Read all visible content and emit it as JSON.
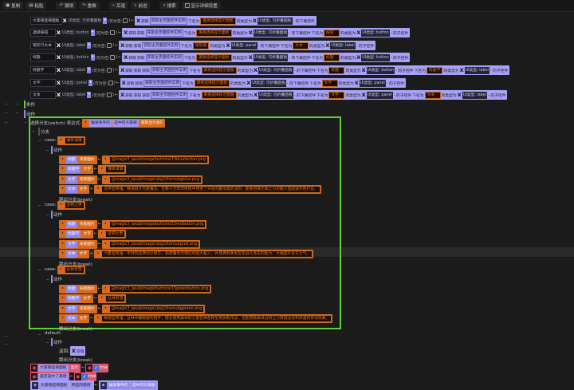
{
  "toolbar": {
    "items": [
      {
        "icon": "copy-icon",
        "label": "复制"
      },
      {
        "icon": "paste-icon",
        "label": "粘贴"
      },
      {
        "icon": "undo-icon",
        "label": "撤销"
      },
      {
        "icon": "redo-icon",
        "label": "重做"
      },
      {
        "icon": "back-icon",
        "label": "后退"
      },
      {
        "icon": "forward-icon",
        "label": "前进"
      },
      {
        "icon": "search-icon",
        "label": "搜索"
      }
    ],
    "detail_checkbox": "显示详细设置"
  },
  "vars": [
    {
      "name": "大美德选择面板",
      "type": "UI类型: 可折叠面板",
      "chain": [
        [
          "x",
          ""
        ],
        [
          "txt",
          "获取"
        ],
        [
          "inner",
          "获取主页面控件实例"
        ],
        [
          "txt",
          "下名为"
        ],
        [
          "str",
          "美德选择提示面板"
        ],
        [
          "txt",
          "的类型为"
        ],
        [
          "x",
          ""
        ],
        [
          "typ",
          "UI类型: 可折叠面板"
        ],
        [
          "txt",
          "- 的下属控件"
        ]
      ]
    },
    {
      "name": "选择按钮",
      "type": "UI类型: button",
      "chain": [
        [
          "x",
          ""
        ],
        [
          "txt",
          "获取"
        ],
        [
          "txt",
          "获取"
        ],
        [
          "inner",
          "获取主页面控件实例"
        ],
        [
          "txt",
          "下名为"
        ],
        [
          "str",
          "美德选择提示面板"
        ],
        [
          "txt",
          "的类型为"
        ],
        [
          "x",
          ""
        ],
        [
          "typ",
          "UI类型: 可折叠面板"
        ],
        [
          "txt",
          "- 的下属控件"
        ],
        [
          "txt",
          "下名为"
        ],
        [
          "str",
          "按钮"
        ],
        [
          "txt",
          "的类型为"
        ],
        [
          "x",
          ""
        ],
        [
          "typ",
          "UI类型: button"
        ],
        [
          "txt",
          "- 的子控件"
        ]
      ]
    },
    {
      "name": "矩形行文本",
      "type": "UI类型: label",
      "chain": [
        [
          "x",
          ""
        ],
        [
          "txt",
          "获取"
        ],
        [
          "txt",
          "获取"
        ],
        [
          "inner",
          "获取主页面控件实例"
        ],
        [
          "txt",
          "下名为"
        ],
        [
          "str",
          "矩形框"
        ],
        [
          "txt",
          "的类型为"
        ],
        [
          "x",
          ""
        ],
        [
          "typ",
          "UI类型: panel"
        ],
        [
          "txt",
          "- 的下属控件"
        ],
        [
          "txt",
          "下名为"
        ],
        [
          "str",
          "文本"
        ],
        [
          "txt",
          "的类型为"
        ],
        [
          "x",
          ""
        ],
        [
          "typ",
          "UI类型: label"
        ],
        [
          "txt",
          "- 的子控件"
        ]
      ]
    },
    {
      "name": "标题",
      "type": "UI类型: button",
      "chain": [
        [
          "x",
          ""
        ],
        [
          "txt",
          "获取"
        ],
        [
          "txt",
          "获取"
        ],
        [
          "inner",
          "获取主页面控件实例"
        ],
        [
          "txt",
          "下名为"
        ],
        [
          "str",
          "美德选择提示面板"
        ],
        [
          "txt",
          "的类型为"
        ],
        [
          "x",
          ""
        ],
        [
          "typ",
          "UI类型: 可折叠面板"
        ],
        [
          "txt",
          "- 的下属控件"
        ],
        [
          "txt",
          "下名为"
        ],
        [
          "str",
          "标题"
        ],
        [
          "txt",
          "的类型为"
        ],
        [
          "x",
          ""
        ],
        [
          "typ",
          "UI类型: button"
        ],
        [
          "txt",
          "- 的子控件"
        ]
      ]
    },
    {
      "name": "标题字",
      "type": "UI类型: label",
      "chain": [
        [
          "x",
          ""
        ],
        [
          "txt",
          "获取"
        ],
        [
          "txt",
          "获取"
        ],
        [
          "txt",
          "获取"
        ],
        [
          "inner",
          "获取主页面控件实例"
        ],
        [
          "txt",
          "下名为"
        ],
        [
          "str",
          "美德选择提示面板"
        ],
        [
          "txt",
          "的类型为"
        ],
        [
          "x",
          ""
        ],
        [
          "typ",
          "UI类型: 可折叠面板"
        ],
        [
          "txt",
          "- 的下属控件"
        ],
        [
          "txt",
          "下名为"
        ],
        [
          "str",
          "标题"
        ],
        [
          "txt",
          "的类型为"
        ],
        [
          "x",
          ""
        ],
        [
          "typ",
          "UI类型: button"
        ],
        [
          "txt",
          "- 的子控件"
        ],
        [
          "txt",
          "下名为"
        ],
        [
          "str",
          "标题字"
        ],
        [
          "txt",
          "的类型为"
        ],
        [
          "x",
          ""
        ],
        [
          "typ",
          "UI类型: label"
        ],
        [
          "txt",
          "- 的子控件"
        ]
      ]
    },
    {
      "name": "文字",
      "type": "UI类型: panel",
      "chain": [
        [
          "x",
          ""
        ],
        [
          "txt",
          "获取"
        ],
        [
          "txt",
          "获取"
        ],
        [
          "inner",
          "获取主页面控件实例"
        ],
        [
          "txt",
          "下名为"
        ],
        [
          "str",
          "美德选择提示面板"
        ],
        [
          "txt",
          "的类型为"
        ],
        [
          "x",
          ""
        ],
        [
          "typ",
          "UI类型: 可折叠面板"
        ],
        [
          "txt",
          "- 的下属控件"
        ],
        [
          "txt",
          "下名为"
        ],
        [
          "str",
          "文字"
        ],
        [
          "txt",
          "的类型为"
        ],
        [
          "x",
          ""
        ],
        [
          "typ",
          "UI类型: panel"
        ],
        [
          "txt",
          "- 的子控件"
        ]
      ]
    },
    {
      "name": "文本",
      "type": "UI类型: label",
      "chain": [
        [
          "x",
          ""
        ],
        [
          "txt",
          "获取"
        ],
        [
          "txt",
          "获取"
        ],
        [
          "txt",
          "获取"
        ],
        [
          "inner",
          "获取主页面控件实例"
        ],
        [
          "txt",
          "下名为"
        ],
        [
          "str",
          "美德选择提示面板"
        ],
        [
          "txt",
          "的类型为"
        ],
        [
          "x",
          ""
        ],
        [
          "typ",
          "UI类型: 可折叠面板"
        ],
        [
          "txt",
          "- 的下属控件"
        ],
        [
          "txt",
          "下名为"
        ],
        [
          "str",
          "文字"
        ],
        [
          "txt",
          "的类型为"
        ],
        [
          "x",
          ""
        ],
        [
          "typ",
          "UI类型: panel"
        ],
        [
          "txt",
          "- 的子控件"
        ],
        [
          "txt",
          "下名为"
        ],
        [
          "str",
          "文本"
        ],
        [
          "txt",
          "的类型为"
        ],
        [
          "x",
          ""
        ],
        [
          "typ",
          "UI类型: label"
        ],
        [
          "txt",
          "- 的子控件"
        ]
      ]
    }
  ],
  "nullable_label": "(可为空:",
  "condition_label": "条件",
  "action_label": "动作",
  "switch": {
    "label": "选择分支(switch) 表达式:",
    "expr": [
      "触发事件的",
      "选中的大美德",
      "获取显示名0"
    ],
    "branch_label": "分支",
    "case_label": "case:",
    "break_label": "跳出分支(break)",
    "cases": [
      {
        "value": "谦卑谨慎",
        "items": [
          [
            "标题",
            "背景图片",
            "@magic3_qeub/image/buttons/13bluebutton.png"
          ],
          [
            "标题字",
            "文字",
            "谦卑谨慎"
          ],
          [
            "文字",
            "背景图片",
            "@magic3_qeub/image/ubg2/itemubgblue.png"
          ],
          [
            "文本",
            "文字",
            "法术型英雄，精通四大元素魔法，在数十万年的修炼中领悟了天地间最深奥的法则，能够召唤元素之力对敌人造成毁灭性打击。"
          ]
        ]
      },
      {
        "value": "坚韧之勇",
        "items": [
          [
            "标题",
            "背景图片",
            "@magic3_qeub/image/buttons/15redbutton.png"
          ],
          [
            "标题字",
            "文字",
            "坚韧之勇"
          ],
          [
            "文字",
            "背景图片",
            "@magic3_qeub/image/ubg2/itemubgred.png"
          ],
          [
            "文本",
            "文字",
            "力量型英雄，手持烈焰神剑之锋芒，驰骋疆场无惧任何强大敌人，并且拥有激发友军战斗意志的能力，大幅提升全方士气。"
          ]
        ]
      },
      {
        "value": "丛林智慧",
        "items": [
          [
            "标题",
            "背景图片",
            "@magic3_qeub/image/buttons/15greenbutton.png"
          ],
          [
            "标题字",
            "文字",
            "丛林智慧"
          ],
          [
            "文字",
            "背景图片",
            "@magic3_qeub/image/ubg2/itemubggreen.png"
          ],
          [
            "文本",
            "文字",
            "敏捷型英雄，丛林中最敏捷的猎手，擅长使用森林的力量召唤各种生物协助作战，还能借助森林古树之力获得治愈和快速的移动效果。"
          ]
        ]
      }
    ],
    "default_label": "default:",
    "return_label": "返回:",
    "return_value": "空值"
  },
  "bottom": [
    {
      "target": "大美德选择面板",
      "prop": "显示",
      "value": "true"
    },
    {
      "target": "是否选中了美德",
      "value": "true"
    },
    {
      "target": "大美德选择面板",
      "prop": "所选的美德",
      "src": [
        "触发事件的",
        "选中的大美德"
      ]
    }
  ]
}
